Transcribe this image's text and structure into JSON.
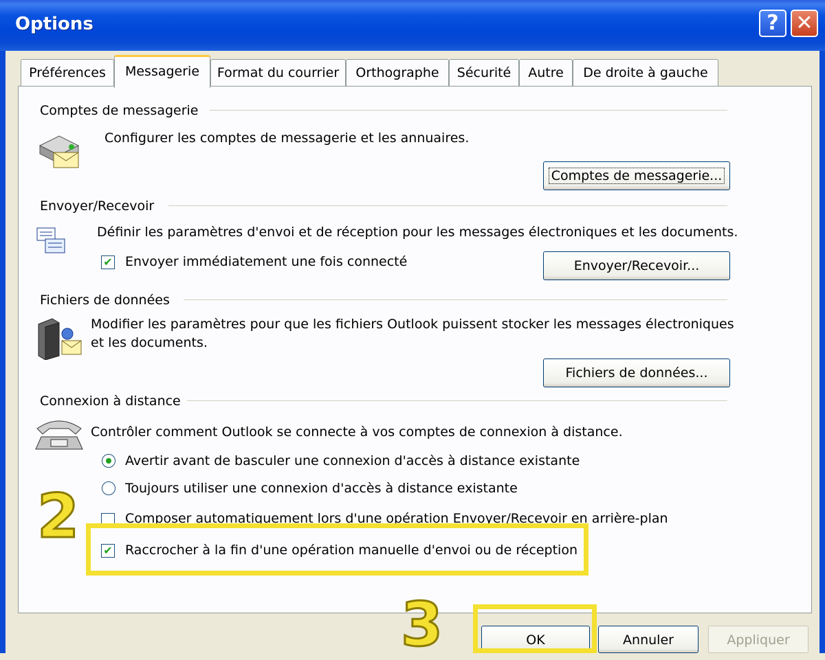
{
  "window": {
    "title": "Options"
  },
  "titlebar_buttons": {
    "help": "?",
    "close": "✕"
  },
  "tabs": [
    {
      "label": "Préférences",
      "active": false
    },
    {
      "label": "Messagerie",
      "active": true
    },
    {
      "label": "Format du courrier",
      "active": false
    },
    {
      "label": "Orthographe",
      "active": false
    },
    {
      "label": "Sécurité",
      "active": false
    },
    {
      "label": "Autre",
      "active": false
    },
    {
      "label": "De droite à gauche",
      "active": false
    }
  ],
  "sections": {
    "mail_accounts": {
      "heading": "Comptes de messagerie",
      "description": "Configurer les comptes de messagerie et les annuaires.",
      "button": "Comptes de messagerie..."
    },
    "send_receive": {
      "heading": "Envoyer/Recevoir",
      "description": "Définir les paramètres d'envoi et de réception pour les messages électroniques et les documents.",
      "checkbox_label": "Envoyer immédiatement une fois connecté",
      "checkbox_checked": true,
      "button": "Envoyer/Recevoir..."
    },
    "data_files": {
      "heading": "Fichiers de données",
      "description_line1": "Modifier les paramètres pour que les fichiers Outlook puissent stocker les messages électroniques",
      "description_line2": "et les documents.",
      "button": "Fichiers de données..."
    },
    "dialup": {
      "heading": "Connexion à distance",
      "description": "Contrôler comment Outlook se connecte à vos comptes de connexion à distance.",
      "radio1": "Avertir avant de basculer une connexion d'accès à distance existante",
      "radio1_selected": true,
      "radio2": "Toujours utiliser une connexion d'accès à distance existante",
      "radio2_selected": false,
      "checkbox1": "Composer automatiquement lors d'une opération Envoyer/Recevoir en arrière-plan",
      "checkbox1_checked": false,
      "checkbox2": "Raccrocher à la fin d'une opération manuelle d'envoi ou de réception",
      "checkbox2_checked": true
    }
  },
  "footer": {
    "ok": "OK",
    "cancel": "Annuler",
    "apply": "Appliquer"
  },
  "callouts": {
    "step2": "2",
    "step3": "3"
  },
  "colors": {
    "titlebar": "#0046d8",
    "callout": "#f4e030",
    "check": "#21a121"
  }
}
